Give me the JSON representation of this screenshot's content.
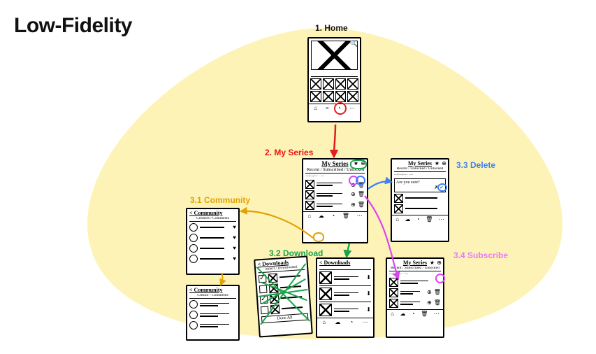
{
  "title": "Low-Fidelity",
  "screens": {
    "home": {
      "label": "1. Home"
    },
    "my_series": {
      "label": "2. My Series",
      "header": "My Series",
      "tabs": "Recent / Subscribed / Unlocked"
    },
    "community": {
      "label": "3.1  Community",
      "header_top": "< Community",
      "sub_top": "Creators / Comments",
      "header_bot": "< Community",
      "sub_bot": "Creator / Comments"
    },
    "download": {
      "label": "3.2  Download",
      "sel_header": "< Downloads",
      "sel_sub": "Select / Downloaded",
      "dl_header": "< Downloads"
    },
    "delete": {
      "label": "3.3  Delete",
      "header": "My Series",
      "tabs": "Recent / Unlocked / Unlocked",
      "confirm": "Are you sure?"
    },
    "subscribe": {
      "label": "3.4  Subscribe",
      "header": "My Series",
      "tabs": "Recent / Subscribed / Unlocked"
    }
  },
  "icons": {
    "search": "🔍",
    "home": "⌂",
    "list": "≡",
    "user": "◔",
    "dots": "⋯",
    "trash": "🗑",
    "download": "⬇",
    "plus": "⊕",
    "star": "★",
    "heart": "♥",
    "yes": "✓",
    "no": "✗",
    "bell": "◔",
    "cloud": "☁"
  },
  "colors": {
    "blob": "#fef3b6",
    "red": "#e11d1d",
    "yellow": "#e0a300",
    "green": "#19a34a",
    "blue": "#3b82f6",
    "magenta": "#d946ef"
  }
}
